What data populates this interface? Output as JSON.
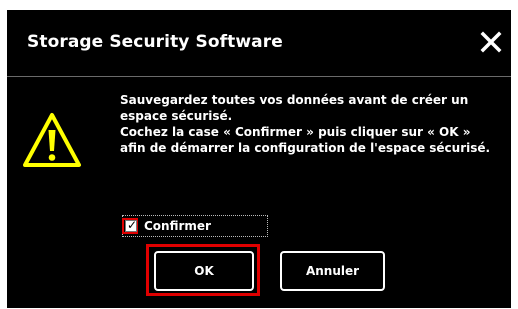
{
  "dialog": {
    "title": "Storage Security Software",
    "close_icon": "close-icon",
    "warning_icon": "warning-triangle-icon",
    "message_line1": "Sauvegardez toutes vos données avant de créer un espace sécurisé.",
    "message_line2": "Cochez la case « Confirmer » puis cliquer sur « OK » afin de démarrer la configuration de l'espace sécurisé.",
    "confirm_label": "Confirmer",
    "confirm_checked": true,
    "ok_label": "OK",
    "cancel_label": "Annuler"
  },
  "colors": {
    "background": "#000000",
    "text": "#ffffff",
    "highlight": "#e00000",
    "warning": "#ffff00"
  }
}
